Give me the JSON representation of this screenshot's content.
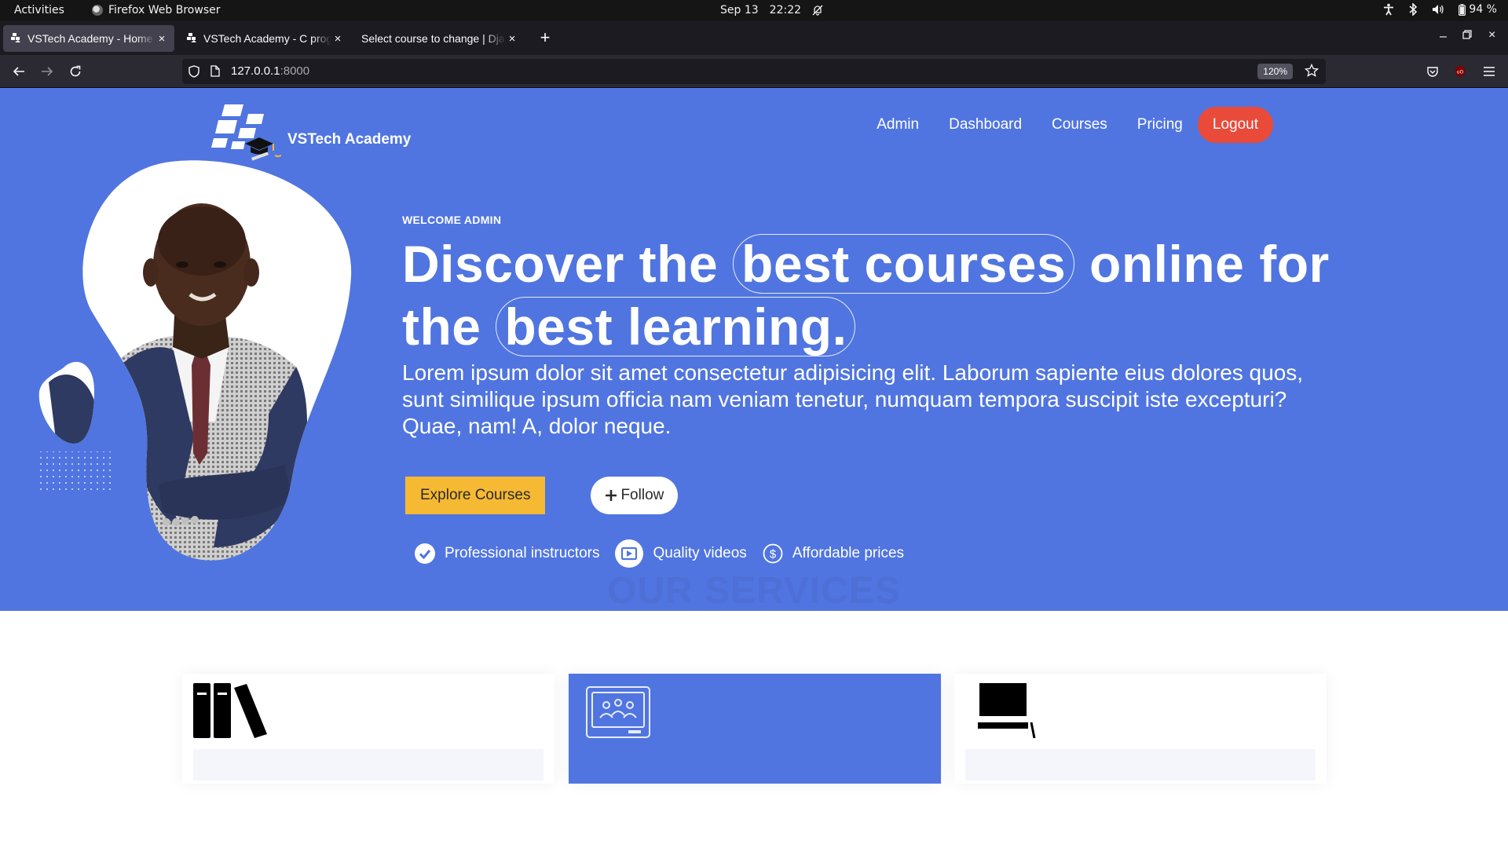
{
  "system_bar": {
    "activities": "Activities",
    "app_name": "Firefox Web Browser",
    "date": "Sep 13",
    "time": "22:22",
    "battery": "94 %"
  },
  "browser": {
    "tabs": [
      {
        "title": "VSTech Academy - Home",
        "active": true
      },
      {
        "title": "VSTech Academy - C programming",
        "active": false
      },
      {
        "title": "Select course to change | Django",
        "active": false
      }
    ],
    "url_host": "127.0.0.1",
    "url_port": ":8000",
    "zoom": "120%"
  },
  "site": {
    "brand": "VSTech Academy",
    "nav": [
      "Admin",
      "Dashboard",
      "Courses",
      "Pricing"
    ],
    "logout": "Logout",
    "eyebrow": "WELCOME ADMIN",
    "headline": {
      "p1": "Discover the",
      "pill1": "best courses",
      "p2": "online for",
      "p3": "the",
      "pill2": "best learning."
    },
    "lede": "Lorem ipsum dolor sit amet consectetur adipisicing elit. Laborum sapiente eius dolores quos, sunt similique ipsum officia nam veniam tenetur, numquam tempora suscipit iste excepturi? Quae, nam! A, dolor neque.",
    "explore": "Explore Courses",
    "follow": "Follow",
    "features": [
      "Professional instructors",
      "Quality videos",
      "Affordable prices"
    ],
    "services_title": "OUR SERVICES",
    "service_icons": [
      "books-icon",
      "online-class-icon",
      "desktop-computer-icon"
    ]
  },
  "colors": {
    "hero_bg": "#5075e0",
    "accent_yellow": "#f6b933",
    "logout_red": "#e94a3a",
    "services_blue": "#4d6fd6"
  }
}
